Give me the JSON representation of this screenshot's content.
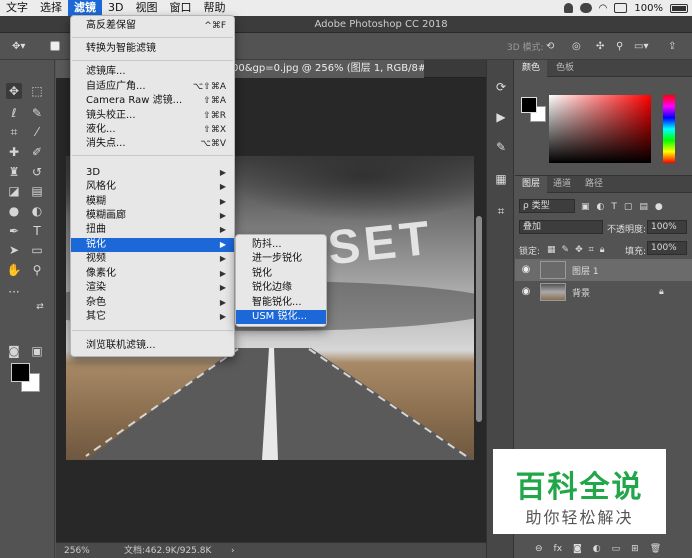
{
  "menubar": {
    "items": [
      "文字",
      "选择",
      "滤镜",
      "3D",
      "视图",
      "窗口",
      "帮助"
    ],
    "battery": "100%"
  },
  "window": {
    "title": "Adobe Photoshop CC 2018"
  },
  "document": {
    "tab_title": "00&gp=0.jpg @ 256% (图层 1, RGB/8#) *",
    "zoom": "256%",
    "doc_size": "文档:462.9K/925.8K",
    "canvas_text": "SET"
  },
  "optbar": {
    "mode_3d": "3D 模式:"
  },
  "filter_menu": {
    "sections": [
      [
        {
          "label": "高反差保留",
          "shortcut": "^⌘F"
        }
      ],
      [
        {
          "label": "转换为智能滤镜",
          "shortcut": ""
        }
      ],
      [
        {
          "label": "滤镜库...",
          "shortcut": ""
        },
        {
          "label": "自适应广角...",
          "shortcut": "⌥⇧⌘A"
        },
        {
          "label": "Camera Raw 滤镜...",
          "shortcut": "⇧⌘A"
        },
        {
          "label": "镜头校正...",
          "shortcut": "⇧⌘R"
        },
        {
          "label": "液化...",
          "shortcut": "⇧⌘X"
        },
        {
          "label": "消失点...",
          "shortcut": "⌥⌘V"
        }
      ],
      [
        {
          "label": "3D",
          "submenu": true
        },
        {
          "label": "风格化",
          "submenu": true
        },
        {
          "label": "模糊",
          "submenu": true
        },
        {
          "label": "模糊画廊",
          "submenu": true
        },
        {
          "label": "扭曲",
          "submenu": true
        },
        {
          "label": "锐化",
          "submenu": true,
          "highlighted": true
        },
        {
          "label": "视频",
          "submenu": true
        },
        {
          "label": "像素化",
          "submenu": true
        },
        {
          "label": "渲染",
          "submenu": true
        },
        {
          "label": "杂色",
          "submenu": true
        },
        {
          "label": "其它",
          "submenu": true
        }
      ],
      [
        {
          "label": "浏览联机滤镜...",
          "shortcut": ""
        }
      ]
    ]
  },
  "sharpen_submenu": {
    "items": [
      {
        "label": "防抖..."
      },
      {
        "label": "进一步锐化"
      },
      {
        "label": "锐化"
      },
      {
        "label": "锐化边缘"
      },
      {
        "label": "智能锐化..."
      },
      {
        "label": "USM 锐化...",
        "highlighted": true
      }
    ]
  },
  "color_panel": {
    "tabs": [
      "颜色",
      "色板"
    ]
  },
  "layers_panel": {
    "tabs": [
      "图层",
      "通道",
      "路径"
    ],
    "filter_kind": "ρ 类型",
    "blend_mode": "叠加",
    "opacity_label": "不透明度:",
    "opacity_value": "100%",
    "lock_label": "锁定:",
    "fill_label": "填充:",
    "fill_value": "100%",
    "layers": [
      {
        "name": "图层 1",
        "selected": true,
        "locked": false
      },
      {
        "name": "背景",
        "selected": false,
        "locked": true
      }
    ]
  },
  "watermark": {
    "title": "百科全说",
    "subtitle": "助你轻松解决"
  }
}
